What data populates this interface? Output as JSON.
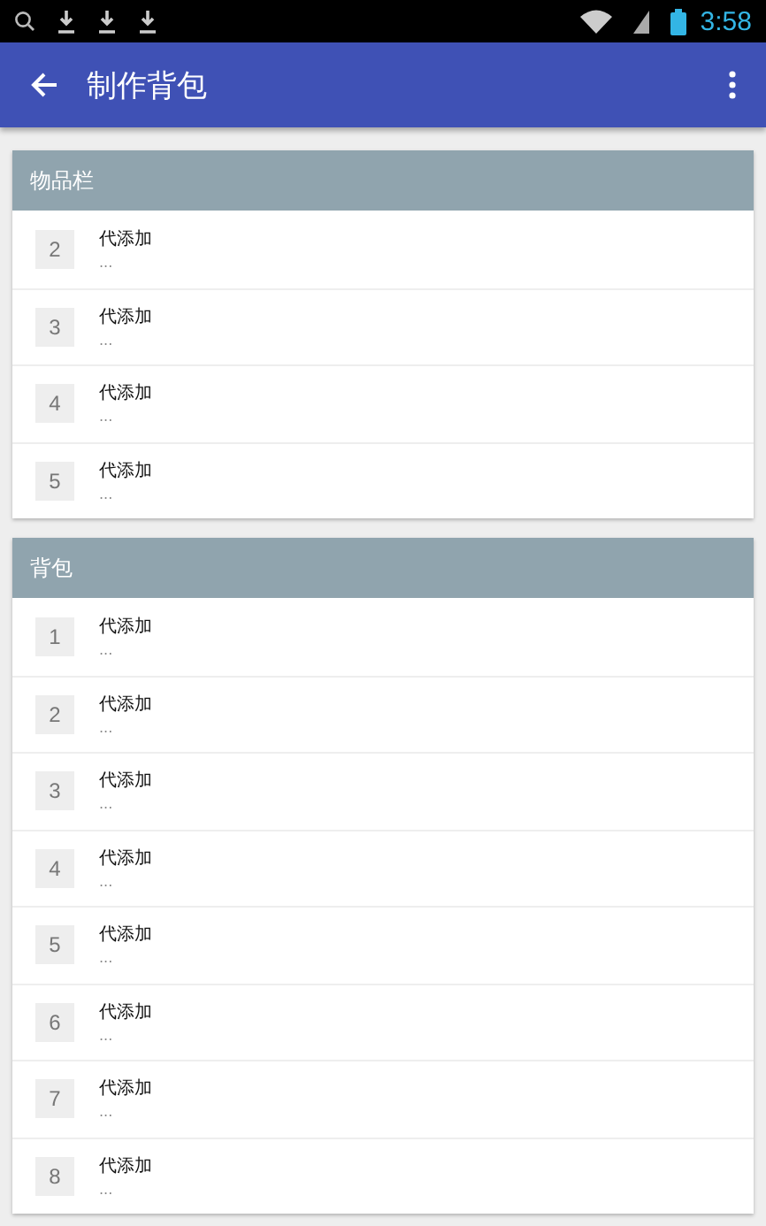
{
  "status_bar": {
    "time": "3:58"
  },
  "app_bar": {
    "title": "制作背包"
  },
  "sections": [
    {
      "title": "物品栏",
      "items": [
        {
          "number": "2",
          "label": "代添加",
          "detail": "..."
        },
        {
          "number": "3",
          "label": "代添加",
          "detail": "..."
        },
        {
          "number": "4",
          "label": "代添加",
          "detail": "..."
        },
        {
          "number": "5",
          "label": "代添加",
          "detail": "..."
        }
      ]
    },
    {
      "title": "背包",
      "items": [
        {
          "number": "1",
          "label": "代添加",
          "detail": "..."
        },
        {
          "number": "2",
          "label": "代添加",
          "detail": "..."
        },
        {
          "number": "3",
          "label": "代添加",
          "detail": "..."
        },
        {
          "number": "4",
          "label": "代添加",
          "detail": "..."
        },
        {
          "number": "5",
          "label": "代添加",
          "detail": "..."
        },
        {
          "number": "6",
          "label": "代添加",
          "detail": "..."
        },
        {
          "number": "7",
          "label": "代添加",
          "detail": "..."
        },
        {
          "number": "8",
          "label": "代添加",
          "detail": "..."
        }
      ]
    }
  ]
}
